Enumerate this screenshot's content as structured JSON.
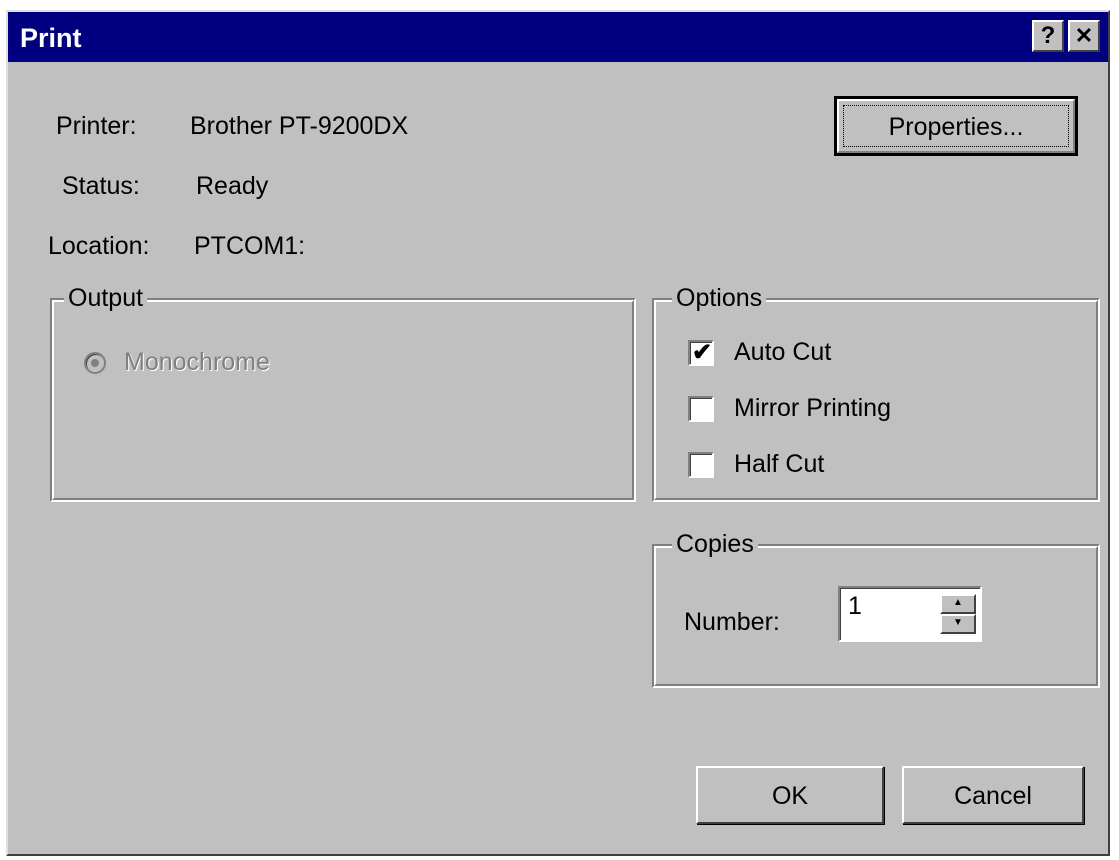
{
  "window": {
    "title": "Print",
    "help_glyph": "?",
    "close_glyph": "✕"
  },
  "printer": {
    "printer_label": "Printer:",
    "printer_value": "Brother PT-9200DX",
    "status_label": "Status:",
    "status_value": "Ready",
    "location_label": "Location:",
    "location_value": "PTCOM1:"
  },
  "buttons": {
    "properties": "Properties...",
    "ok": "OK",
    "cancel": "Cancel"
  },
  "output": {
    "legend": "Output",
    "monochrome_label": "Monochrome",
    "monochrome_selected": true,
    "monochrome_enabled": false
  },
  "options": {
    "legend": "Options",
    "items": [
      {
        "label": "Auto Cut",
        "checked": true
      },
      {
        "label": "Mirror Printing",
        "checked": false
      },
      {
        "label": "Half Cut",
        "checked": false
      }
    ]
  },
  "copies": {
    "legend": "Copies",
    "number_label": "Number:",
    "number_value": "1",
    "up_glyph": "▲",
    "down_glyph": "▼"
  },
  "colors": {
    "face": "#c0c0c0",
    "titlebar": "#000080",
    "disabled_text": "#808080"
  }
}
